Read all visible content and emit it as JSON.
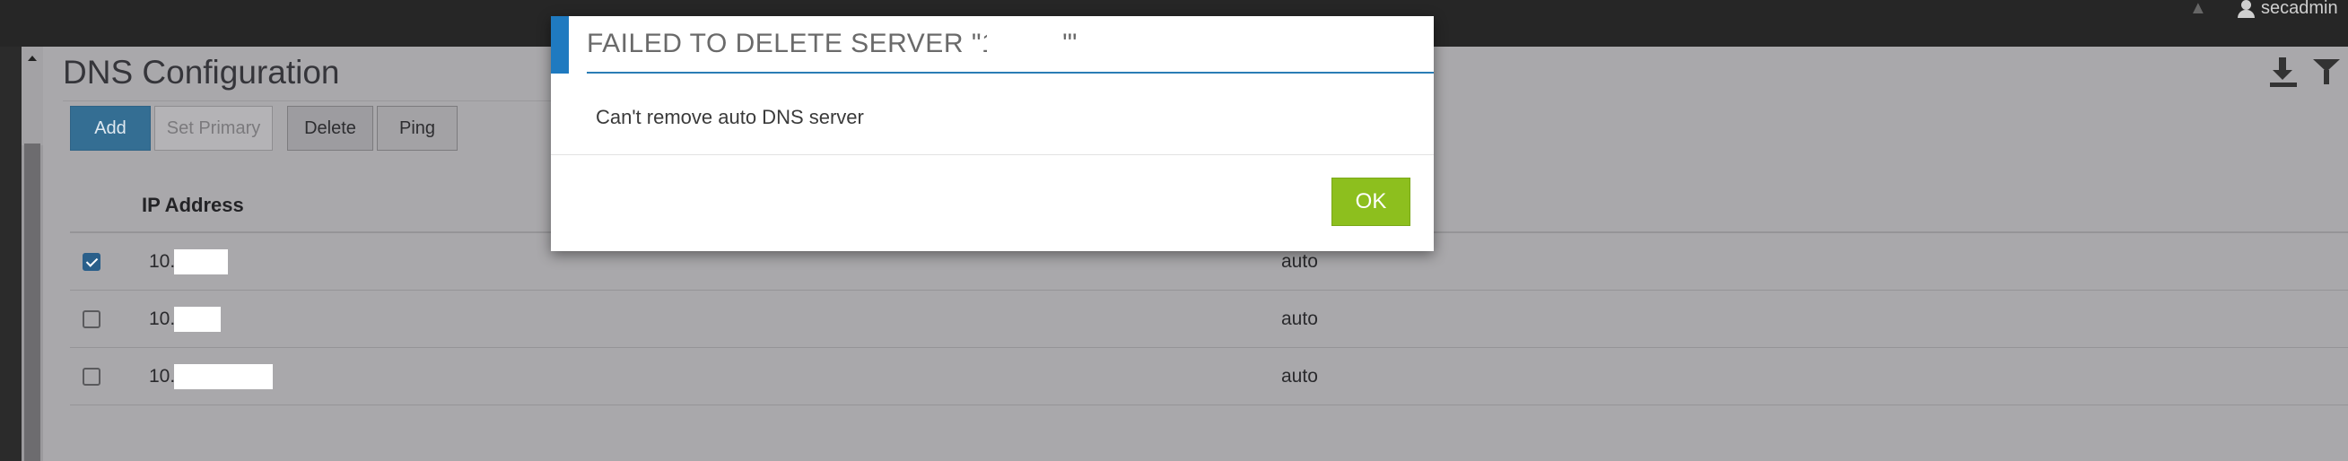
{
  "topbar": {
    "username": "secadmin"
  },
  "page": {
    "title": "DNS Configuration"
  },
  "toolbar": {
    "add_label": "Add",
    "set_primary_label": "Set Primary",
    "delete_label": "Delete",
    "ping_label": "Ping",
    "icons": [
      "download-icon",
      "filter-icon"
    ]
  },
  "table": {
    "columns": [
      "IP Address"
    ],
    "rows": [
      {
        "ip": "10.",
        "source": "auto",
        "checked": true
      },
      {
        "ip": "10.",
        "source": "auto",
        "checked": false
      },
      {
        "ip": "10.",
        "source": "auto",
        "checked": false
      }
    ]
  },
  "dialog": {
    "title": "FAILED TO DELETE SERVER \"10.",
    "title_end": "'\"",
    "message": "Can't remove auto DNS server",
    "ok_label": "OK",
    "accent_color": "#1f7ac0",
    "ok_color": "#8dbf1e"
  }
}
